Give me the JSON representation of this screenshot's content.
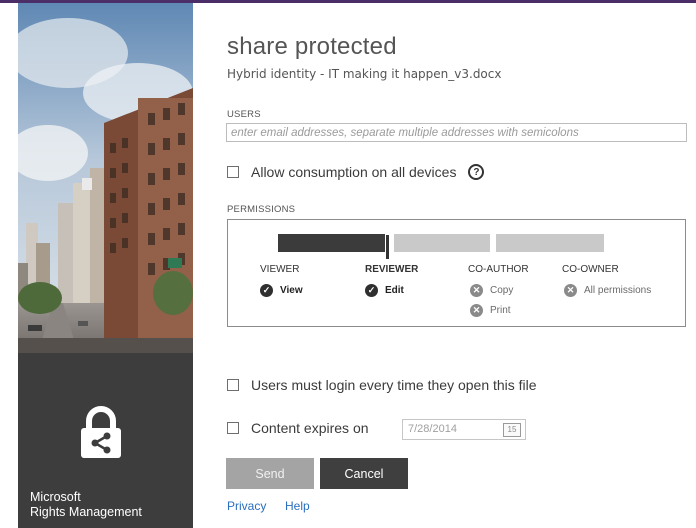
{
  "dialog": {
    "title": "share protected",
    "filename": "Hybrid identity - IT making it happen_v3.docx"
  },
  "users": {
    "label": "USERS",
    "placeholder": "enter email addresses, separate multiple addresses with semicolons"
  },
  "allow_devices": {
    "label": "Allow consumption on all devices",
    "checked": false,
    "help_glyph": "?"
  },
  "permissions": {
    "label": "PERMISSIONS",
    "level": "REVIEWER",
    "levels": [
      {
        "name": "VIEWER",
        "selected": false,
        "capabilities": [
          {
            "text": "View",
            "granted": true
          }
        ]
      },
      {
        "name": "REVIEWER",
        "selected": true,
        "capabilities": [
          {
            "text": "Edit",
            "granted": true
          }
        ]
      },
      {
        "name": "CO-AUTHOR",
        "selected": false,
        "capabilities": [
          {
            "text": "Copy",
            "granted": false
          },
          {
            "text": "Print",
            "granted": false
          }
        ]
      },
      {
        "name": "CO-OWNER",
        "selected": false,
        "capabilities": [
          {
            "text": "All permissions",
            "granted": false
          }
        ]
      }
    ]
  },
  "login_every_time": {
    "label": "Users must login every time they open this file",
    "checked": false
  },
  "expires": {
    "label": "Content expires on",
    "checked": false,
    "date": "7/28/2014",
    "calendar_day": "15"
  },
  "buttons": {
    "send": "Send",
    "cancel": "Cancel"
  },
  "links": {
    "privacy": "Privacy",
    "help": "Help"
  },
  "brand": {
    "line1": "Microsoft",
    "line2": "Rights Management"
  },
  "icons": {
    "granted": "check-circle-icon",
    "denied": "x-circle-icon",
    "help": "question-circle-icon",
    "calendar": "calendar-icon",
    "lock": "lock-share-icon"
  },
  "colors": {
    "accent_top": "#4b2d68",
    "side_dark": "#3d3d3d",
    "link": "#2a6ebd",
    "slider_active": "#3b3b3b",
    "slider_inactive": "#c9c9c9"
  }
}
